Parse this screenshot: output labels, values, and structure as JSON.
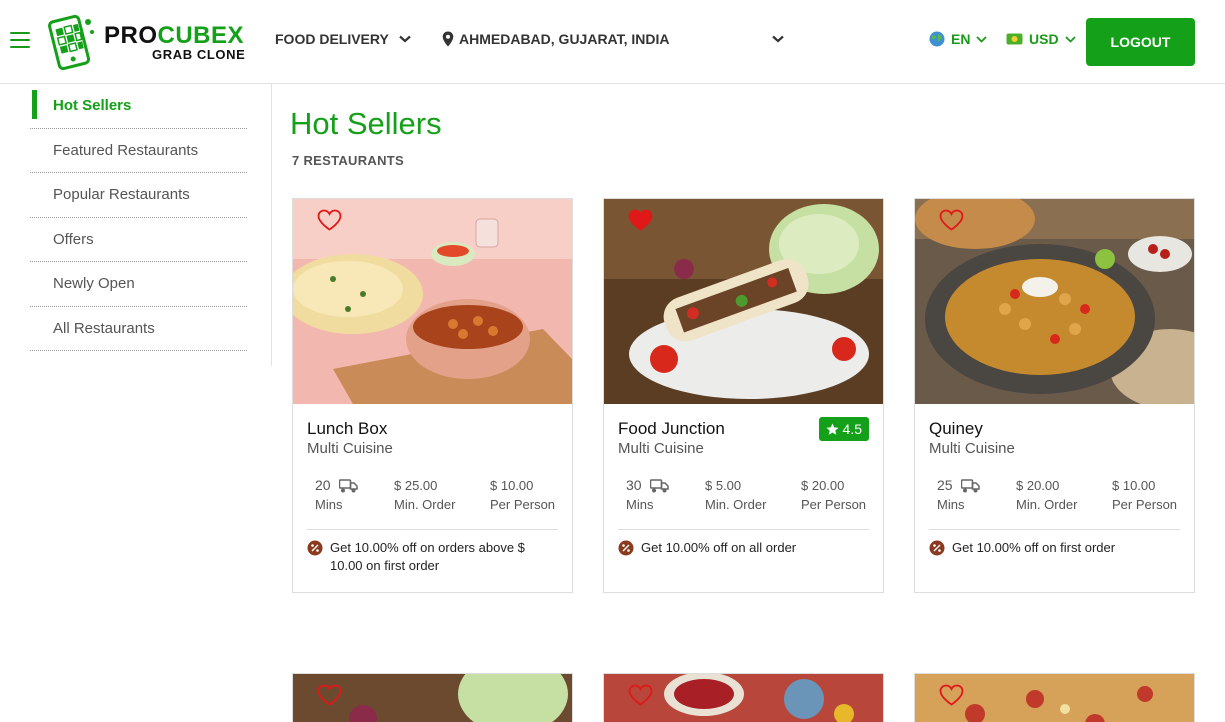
{
  "brand": {
    "name_part1": "PRO",
    "name_part2": "CUBEX",
    "tagline": "GRAB CLONE"
  },
  "header": {
    "service": "FOOD DELIVERY",
    "location": "AHMEDABAD, GUJARAT, INDIA",
    "language": "EN",
    "currency": "USD",
    "logout_label": "LOGOUT"
  },
  "sidebar": {
    "items": [
      {
        "label": "Hot Sellers",
        "active": true
      },
      {
        "label": "Featured Restaurants"
      },
      {
        "label": "Popular Restaurants"
      },
      {
        "label": "Offers"
      },
      {
        "label": "Newly Open"
      },
      {
        "label": "All Restaurants"
      }
    ]
  },
  "main": {
    "title": "Hot Sellers",
    "count": "7 RESTAURANTS",
    "cards": [
      {
        "name": "Lunch Box",
        "cuisine": "Multi Cuisine",
        "favorite": false,
        "rating": "",
        "time": "20",
        "time_unit": "Mins",
        "min_order": "$ 25.00",
        "min_order_label": "Min. Order",
        "per_person": "$ 10.00",
        "per_person_label": "Per Person",
        "offer": "Get 10.00% off on orders above $ 10.00 on first order"
      },
      {
        "name": "Food Junction",
        "cuisine": "Multi Cuisine",
        "favorite": true,
        "rating": "4.5",
        "time": "30",
        "time_unit": "Mins",
        "min_order": "$ 5.00",
        "min_order_label": "Min. Order",
        "per_person": "$ 20.00",
        "per_person_label": "Per Person",
        "offer": "Get 10.00% off on all order"
      },
      {
        "name": "Quiney",
        "cuisine": "Multi Cuisine",
        "favorite": false,
        "rating": "",
        "time": "25",
        "time_unit": "Mins",
        "min_order": "$ 20.00",
        "min_order_label": "Min. Order",
        "per_person": "$ 10.00",
        "per_person_label": "Per Person",
        "offer": "Get 10.00% off on first order"
      }
    ]
  },
  "colors": {
    "brand_green": "#14a019",
    "heart_red": "#e01818"
  },
  "icons": [
    "hamburger-icon",
    "location-pin-icon",
    "chevron-down-icon",
    "globe-icon",
    "currency-icon",
    "heart-icon",
    "star-icon",
    "delivery-truck-icon",
    "discount-icon"
  ]
}
